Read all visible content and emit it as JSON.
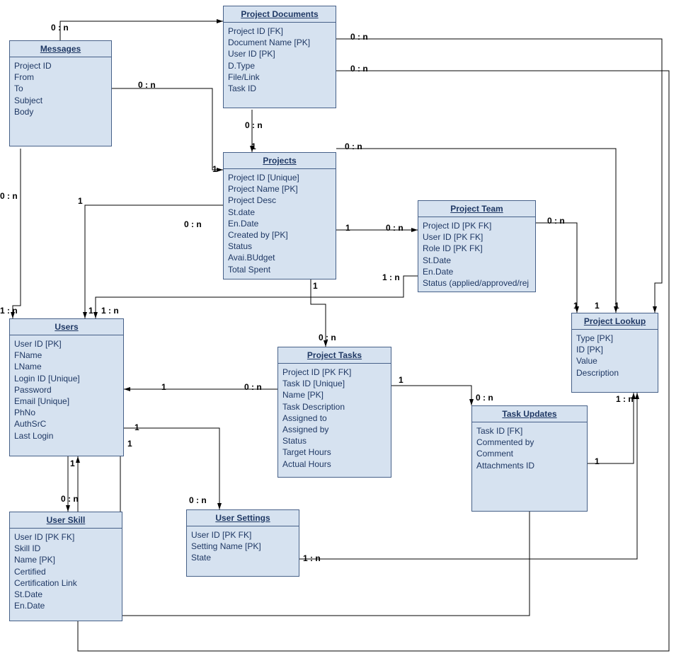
{
  "entities": {
    "messages": {
      "title": "Messages",
      "fields": [
        "Project ID",
        "From",
        "To",
        "Subject",
        "Body"
      ]
    },
    "projectDocuments": {
      "title": "Project Documents",
      "fields": [
        "Project ID [FK]",
        "Document Name [PK]",
        "User ID [PK]",
        "D.Type",
        "File/Link",
        "Task ID"
      ]
    },
    "projects": {
      "title": "Projects",
      "fields": [
        "Project ID [Unique]",
        "Project Name [PK]",
        "Project Desc",
        "St.date",
        "En.Date",
        "Created by [PK]",
        "Status",
        "Avai.BUdget",
        "Total Spent"
      ]
    },
    "users": {
      "title": "Users",
      "fields": [
        "User ID [PK]",
        "FName",
        "LName",
        "Login ID [Unique]",
        "Password",
        "Email  [Unique]",
        "PhNo",
        "AuthSrC",
        "Last Login"
      ]
    },
    "projectTeam": {
      "title": "Project Team",
      "fields": [
        "Project ID [PK FK]",
        "User ID [PK FK]",
        "Role ID [PK FK]",
        "St.Date",
        "En.Date",
        "Status (applied/approved/rej"
      ]
    },
    "projectTasks": {
      "title": "Project Tasks",
      "fields": [
        "Project ID [PK FK]",
        "Task ID [Unique]",
        "Name [PK]",
        "Task Description",
        "Assigned to",
        "Assigned by",
        "Status",
        "Target Hours",
        "Actual Hours"
      ]
    },
    "projectLookup": {
      "title": "Project Lookup",
      "fields": [
        "Type [PK]",
        "ID [PK]",
        "Value",
        "Description"
      ]
    },
    "taskUpdates": {
      "title": "Task Updates",
      "fields": [
        "Task ID [FK]",
        "Commented by",
        "Comment",
        "Attachments ID"
      ]
    },
    "userSkill": {
      "title": "User Skill",
      "fields": [
        "User ID [PK FK]",
        "Skill ID",
        "Name [PK]",
        "Certified",
        "Certification Link",
        "St.Date",
        "En.Date"
      ]
    },
    "userSettings": {
      "title": "User Settings",
      "fields": [
        "User ID [PK FK]",
        "Setting Name [PK]",
        "State"
      ]
    }
  },
  "labels": {
    "l_msg_pd_top": "0 : n",
    "l_msg_proj_top": "0 : n",
    "l_msg_proj_one": "1",
    "l_pd_proj_mid": "0 : n",
    "l_pd_proj_one": "1",
    "l_proj_right_0n": "0 : n",
    "l_pd_right_0n": "0 : n",
    "l_pd_right2_0n": "0 : n",
    "l_msg_users_left_0n": "0 : n",
    "l_msg_users_left_1n": "1 : n",
    "l_users_left_1": "1",
    "l_users_1n_right": "1 : n",
    "l_users_proj_one": "1",
    "l_users_proj_0n": "0 : n",
    "l_proj_team_one": "1",
    "l_proj_team_0n": "0 : n",
    "l_team_users_1n": "1 : n",
    "l_team_lookup_0n": "0 : n",
    "l_lookup_one1": "1",
    "l_lookup_one2": "1",
    "l_lookup_one3": "1",
    "l_lookup_1n": "1 : n",
    "l_proj_tasks_one": "1",
    "l_proj_tasks_0n": "0 : n",
    "l_tasks_users_one": "1",
    "l_tasks_users_0n": "0 : n",
    "l_tasks_updates_one": "1",
    "l_tasks_updates_0n": "0 : n",
    "l_updates_users_one": "1",
    "l_updates_lookup_one": "1",
    "l_users_skill_one": "1",
    "l_users_skill_0n": "0 : n",
    "l_users_settings_one": "1",
    "l_users_settings_0n": "0 : n",
    "l_settings_lookup_1n": "1 : n"
  }
}
